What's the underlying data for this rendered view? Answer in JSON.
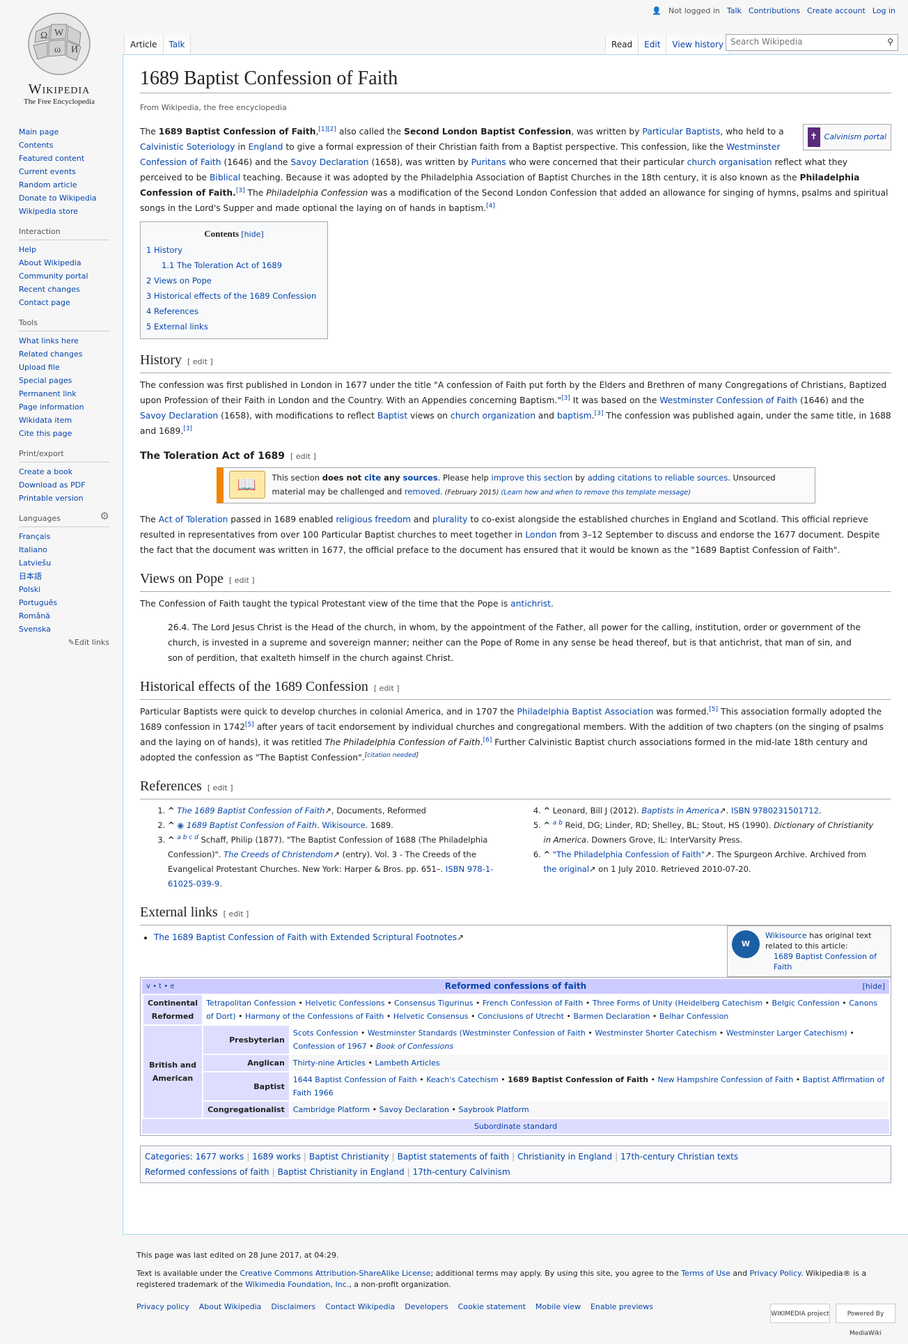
{
  "logo": {
    "wordmark": "Wikipedia",
    "tagline": "The Free Encyclopedia"
  },
  "personal": {
    "status": "Not logged in",
    "links": [
      "Talk",
      "Contributions",
      "Create account",
      "Log in"
    ]
  },
  "tabs": {
    "left": [
      "Article",
      "Talk"
    ],
    "right": [
      "Read",
      "Edit",
      "View history"
    ]
  },
  "search": {
    "placeholder": "Search Wikipedia"
  },
  "sidebar": {
    "navigation": [
      "Main page",
      "Contents",
      "Featured content",
      "Current events",
      "Random article",
      "Donate to Wikipedia",
      "Wikipedia store"
    ],
    "interaction_title": "Interaction",
    "interaction": [
      "Help",
      "About Wikipedia",
      "Community portal",
      "Recent changes",
      "Contact page"
    ],
    "tools_title": "Tools",
    "tools": [
      "What links here",
      "Related changes",
      "Upload file",
      "Special pages",
      "Permanent link",
      "Page information",
      "Wikidata item",
      "Cite this page"
    ],
    "print_title": "Print/export",
    "print": [
      "Create a book",
      "Download as PDF",
      "Printable version"
    ],
    "languages_title": "Languages",
    "languages": [
      "Français",
      "Italiano",
      "Latviešu",
      "日本語",
      "Polski",
      "Português",
      "Română",
      "Svenska"
    ],
    "edit_links": "Edit links"
  },
  "article": {
    "title": "1689 Baptist Confession of Faith",
    "site_sub": "From Wikipedia, the free encyclopedia",
    "portal": "Calvinism portal",
    "toc": {
      "title": "Contents",
      "hide": "[hide]",
      "items": [
        {
          "num": "1",
          "text": "History"
        },
        {
          "num": "1.1",
          "text": "The Toleration Act of 1689"
        },
        {
          "num": "2",
          "text": "Views on Pope"
        },
        {
          "num": "3",
          "text": "Historical effects of the 1689 Confession"
        },
        {
          "num": "4",
          "text": "References"
        },
        {
          "num": "5",
          "text": "External links"
        }
      ]
    },
    "edit": "[ edit ]",
    "h_history": "History",
    "h_toleration": "The Toleration Act of 1689",
    "ambox": {
      "pre": "This section ",
      "does_not": "does not ",
      "cite": "cite",
      "any": " any ",
      "sources": "sources",
      "mid": ". Please help ",
      "improve": "improve this section",
      "by": " by ",
      "adding": "adding citations to reliable sources",
      "mid2": ". Unsourced material may be challenged and ",
      "removed": "removed.",
      "date": " (February 2015) ",
      "learn": "(Learn how and when to remove this template message)"
    },
    "h_views": "Views on Pope",
    "views_p": "The Confession of Faith taught the typical Protestant view of the time that the Pope is ",
    "views_link": "antichrist",
    "quote": "26.4. The Lord Jesus Christ is the Head of the church, in whom, by the appointment of the Father, all power for the calling, institution, order or government of the church, is invested in a supreme and sovereign manner; neither can the Pope of Rome in any sense be head thereof, but is that antichrist, that man of sin, and son of perdition, that exalteth himself in the church against Christ.",
    "h_effects": "Historical effects of the 1689 Confession",
    "h_refs": "References",
    "h_ext": "External links",
    "ext_link": "The 1689 Baptist Confession of Faith with Extended Scriptural Footnotes",
    "wikisource": {
      "pre": "Wikisource",
      "mid": " has original text related to this article:",
      "link": "1689 Baptist Confession of Faith"
    }
  },
  "navbox": {
    "vte": "v • t • e",
    "title": "Reformed confessions of faith",
    "hide": "[hide]",
    "footer": "Subordinate standard",
    "continental_label": "Continental Reformed",
    "continental": [
      "Tetrapolitan Confession",
      "Helvetic Confessions",
      "Consensus Tigurinus",
      "French Confession of Faith",
      "Three Forms of Unity (Heidelberg Catechism",
      "Belgic Confession",
      "Canons of Dort)",
      "Harmony of the Confessions of Faith",
      "Helvetic Consensus",
      "Conclusions of Utrecht",
      "Barmen Declaration",
      "Belhar Confession"
    ],
    "british_label": "British and American",
    "groups": [
      {
        "label": "Presbyterian",
        "items": [
          "Scots Confession",
          "Westminster Standards (Westminster Confession of Faith",
          "Westminster Shorter Catechism",
          "Westminster Larger Catechism)",
          "Confession of 1967",
          "Book of Confessions"
        ]
      },
      {
        "label": "Anglican",
        "items": [
          "Thirty-nine Articles",
          "Lambeth Articles"
        ]
      },
      {
        "label": "Baptist",
        "items": [
          "1644 Baptist Confession of Faith",
          "Keach's Catechism",
          "1689 Baptist Confession of Faith",
          "New Hampshire Confession of Faith",
          "Baptist Affirmation of Faith 1966"
        ]
      },
      {
        "label": "Congregationalist",
        "items": [
          "Cambridge Platform",
          "Savoy Declaration",
          "Saybrook Platform"
        ]
      }
    ]
  },
  "categories": {
    "label": "Categories:",
    "items": [
      "1677 works",
      "1689 works",
      "Baptist Christianity",
      "Baptist statements of faith",
      "Christianity in England",
      "17th-century Christian texts",
      "Reformed confessions of faith",
      "Baptist Christianity in England",
      "17th-century Calvinism"
    ]
  },
  "footer": {
    "edited": "This page was last edited on 28 June 2017, at 04:29.",
    "license_pre": "Text is available under the ",
    "license_link": "Creative Commons Attribution-ShareAlike License",
    "license_mid": "; additional terms may apply. By using this site, you agree to the ",
    "terms": "Terms of Use",
    "and": " and ",
    "privacy": "Privacy Policy",
    "license_end": ". Wikipedia® is a registered trademark of the ",
    "wmf": "Wikimedia Foundation, Inc.",
    "license_tail": ", a non-profit organization.",
    "links": [
      "Privacy policy",
      "About Wikipedia",
      "Disclaimers",
      "Contact Wikipedia",
      "Developers",
      "Cookie statement",
      "Mobile view",
      "Enable previews"
    ],
    "icons": [
      "WIKIMEDIA project",
      "Powered By MediaWiki"
    ]
  }
}
